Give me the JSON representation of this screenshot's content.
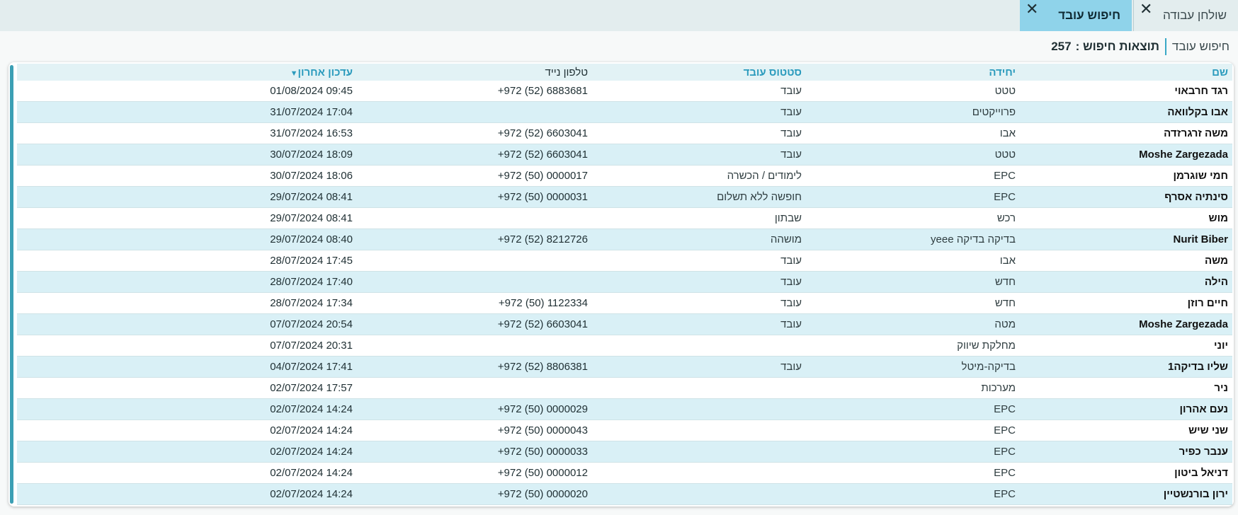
{
  "tabs": [
    {
      "label": "שולחן עבודה"
    },
    {
      "label": "חיפוש עובד"
    }
  ],
  "breadcrumb": {
    "link": "חיפוש עובד",
    "current": "תוצאות חיפוש :",
    "count": "257"
  },
  "table": {
    "columns": {
      "name": "שם",
      "unit": "יחידה",
      "status": "סטטוס עובד",
      "phone": "טלפון נייד",
      "updated": "עדכון אחרון"
    },
    "rows": [
      {
        "name": "רגד חרבאוי",
        "unit": "טטט",
        "status": "עובד",
        "phone": "+972 (52) 6883681",
        "updated": "01/08/2024 09:45"
      },
      {
        "name": "אבו בקלוואה",
        "unit": "פרוייקטים",
        "status": "עובד",
        "phone": "",
        "updated": "31/07/2024 17:04"
      },
      {
        "name": "משה זרגרזדה",
        "unit": "אבו",
        "status": "עובד",
        "phone": "+972 (52) 6603041",
        "updated": "31/07/2024 16:53"
      },
      {
        "name": "Moshe Zargezada",
        "unit": "טטט",
        "status": "עובד",
        "phone": "+972 (52) 6603041",
        "updated": "30/07/2024 18:09"
      },
      {
        "name": "חמי שוגרמן",
        "unit": "EPC",
        "status": "לימודים / הכשרה",
        "phone": "+972 (50) 0000017",
        "updated": "30/07/2024 18:06"
      },
      {
        "name": "סינתיה אסרף",
        "unit": "EPC",
        "status": "חופשה ללא תשלום",
        "phone": "+972 (50) 0000031",
        "updated": "29/07/2024 08:41"
      },
      {
        "name": "מוש",
        "unit": "רכש",
        "status": "שבתון",
        "phone": "",
        "updated": "29/07/2024 08:41"
      },
      {
        "name": "Nurit Biber",
        "unit": "בדיקה בדיקה yeee",
        "status": "מושהה",
        "phone": "+972 (52) 8212726",
        "updated": "29/07/2024 08:40"
      },
      {
        "name": "משה",
        "unit": "אבו",
        "status": "עובד",
        "phone": "",
        "updated": "28/07/2024 17:45"
      },
      {
        "name": "הילה",
        "unit": "חדש",
        "status": "עובד",
        "phone": "",
        "updated": "28/07/2024 17:40"
      },
      {
        "name": "חיים רוזן",
        "unit": "חדש",
        "status": "עובד",
        "phone": "+972 (50) 1122334",
        "updated": "28/07/2024 17:34"
      },
      {
        "name": "Moshe Zargezada",
        "unit": "מטה",
        "status": "עובד",
        "phone": "+972 (52) 6603041",
        "updated": "07/07/2024 20:54"
      },
      {
        "name": "יוני",
        "unit": "מחלקת שיווק",
        "status": "",
        "phone": "",
        "updated": "07/07/2024 20:31"
      },
      {
        "name": "שליו בדיקה1",
        "unit": "בדיקה-מיטל",
        "status": "עובד",
        "phone": "+972 (52) 8806381",
        "updated": "04/07/2024 17:41"
      },
      {
        "name": "ניר",
        "unit": "מערכות",
        "status": "",
        "phone": "",
        "updated": "02/07/2024 17:57"
      },
      {
        "name": "נעם אהרון",
        "unit": "EPC",
        "status": "",
        "phone": "+972 (50) 0000029",
        "updated": "02/07/2024 14:24"
      },
      {
        "name": "שני שיש",
        "unit": "EPC",
        "status": "",
        "phone": "+972 (50) 0000043",
        "updated": "02/07/2024 14:24"
      },
      {
        "name": "ענבר כפיר",
        "unit": "EPC",
        "status": "",
        "phone": "+972 (50) 0000033",
        "updated": "02/07/2024 14:24"
      },
      {
        "name": "דניאל ביטון",
        "unit": "EPC",
        "status": "",
        "phone": "+972 (50) 0000012",
        "updated": "02/07/2024 14:24"
      },
      {
        "name": "ירון בורנשטיין",
        "unit": "EPC",
        "status": "",
        "phone": "+972 (50) 0000020",
        "updated": "02/07/2024 14:24"
      }
    ]
  },
  "icons": {
    "close": "close-icon",
    "sort": "sort-desc-icon"
  },
  "colors": {
    "accent": "#8fd3ea",
    "header_text": "#2b9bbd",
    "row_alt": "#d9f0f6",
    "scrollbar": "#3b9fb4"
  }
}
